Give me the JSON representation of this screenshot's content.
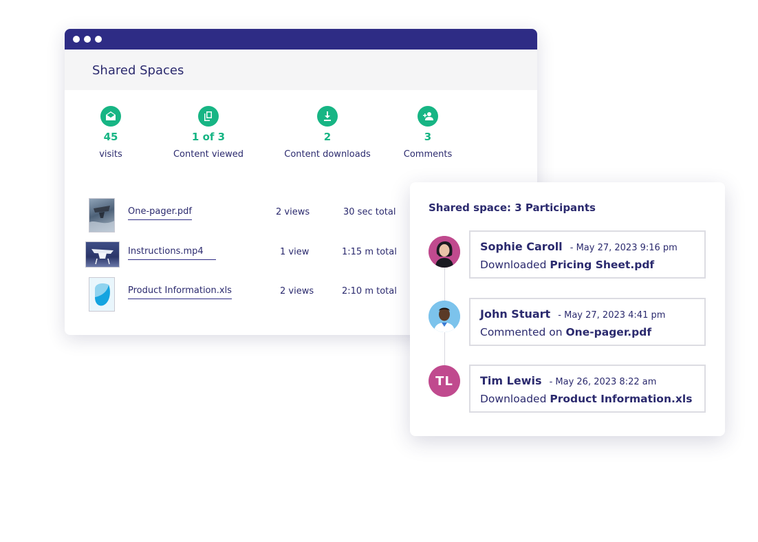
{
  "window": {
    "title": "Shared Spaces",
    "titlebar_color": "#2e2c85",
    "accent_color": "#17b584"
  },
  "stats": [
    {
      "icon": "envelope-open-icon",
      "value": "45",
      "label": "visits"
    },
    {
      "icon": "copy-icon",
      "value": "1 of 3",
      "label": "Content viewed"
    },
    {
      "icon": "download-icon",
      "value": "2",
      "label": "Content downloads"
    },
    {
      "icon": "person-add-icon",
      "value": "3",
      "label": "Comments"
    }
  ],
  "files": [
    {
      "name": "One-pager.pdf",
      "views": "2 views",
      "time": "30 sec total"
    },
    {
      "name": "Instructions.mp4",
      "views": "1 view",
      "time": "1:15 m total"
    },
    {
      "name": "Product Information.xls",
      "views": "2 views",
      "time": "2:10 m total"
    }
  ],
  "participants_card": {
    "title": "Shared space: 3 Participants",
    "activities": [
      {
        "name": "Sophie Caroll",
        "date": "- May 27, 2023 9:16 pm",
        "action": "Downloaded",
        "target": "Pricing Sheet.pdf",
        "avatar": "photo"
      },
      {
        "name": "John Stuart",
        "date": "- May 27, 2023 4:41 pm",
        "action": "Commented on",
        "target": "One-pager.pdf",
        "avatar": "photo"
      },
      {
        "name": "Tim Lewis",
        "date": "- May 26, 2023 8:22 am",
        "action": "Downloaded",
        "target": "Product Information.xls",
        "avatar": "initials",
        "initials": "TL",
        "avatar_color": "#c04a8e"
      }
    ]
  }
}
